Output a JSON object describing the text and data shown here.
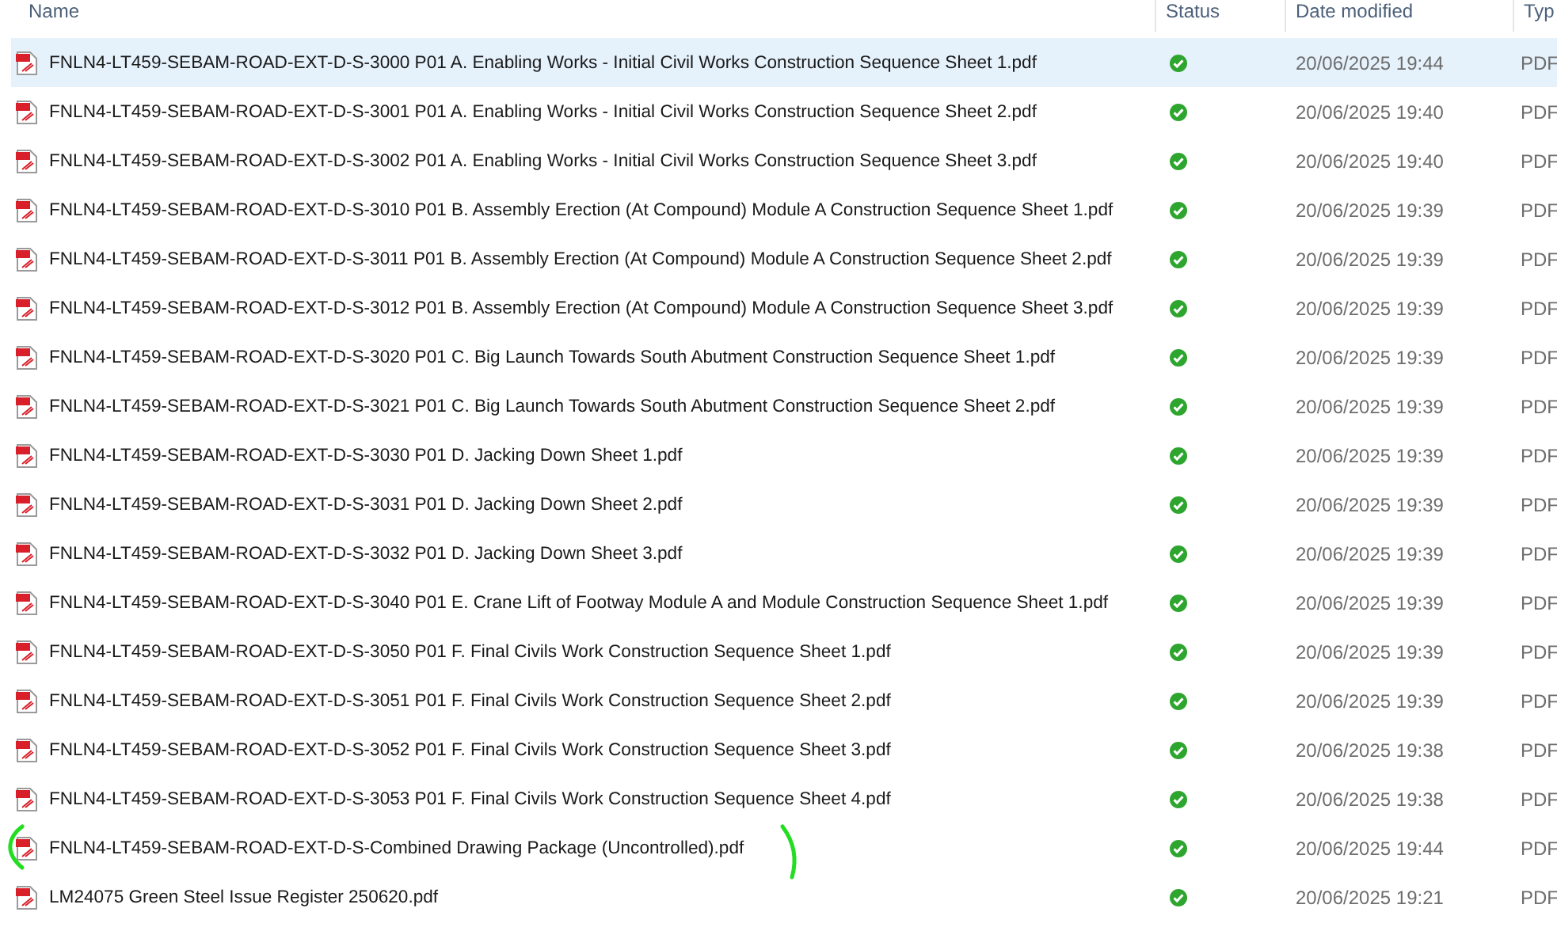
{
  "columns": [
    {
      "label": "Name"
    },
    {
      "label": "Status"
    },
    {
      "label": "Date modified"
    },
    {
      "label": "Typ"
    }
  ],
  "rows": [
    {
      "name": "FNLN4-LT459-SEBAM-ROAD-EXT-D-S-3000 P01 A. Enabling Works - Initial Civil Works Construction Sequence Sheet 1.pdf",
      "synced": true,
      "date": "20/06/2025 19:44",
      "type": "PDF",
      "selected": true
    },
    {
      "name": "FNLN4-LT459-SEBAM-ROAD-EXT-D-S-3001 P01 A. Enabling Works - Initial Civil Works Construction Sequence Sheet 2.pdf",
      "synced": true,
      "date": "20/06/2025 19:40",
      "type": "PDF",
      "selected": false
    },
    {
      "name": "FNLN4-LT459-SEBAM-ROAD-EXT-D-S-3002 P01 A. Enabling Works - Initial Civil Works Construction Sequence Sheet 3.pdf",
      "synced": true,
      "date": "20/06/2025 19:40",
      "type": "PDF",
      "selected": false
    },
    {
      "name": "FNLN4-LT459-SEBAM-ROAD-EXT-D-S-3010 P01 B. Assembly Erection (At Compound) Module A Construction Sequence Sheet 1.pdf",
      "synced": true,
      "date": "20/06/2025 19:39",
      "type": "PDF",
      "selected": false
    },
    {
      "name": "FNLN4-LT459-SEBAM-ROAD-EXT-D-S-3011 P01 B. Assembly Erection (At Compound) Module A Construction Sequence Sheet 2.pdf",
      "synced": true,
      "date": "20/06/2025 19:39",
      "type": "PDF",
      "selected": false
    },
    {
      "name": "FNLN4-LT459-SEBAM-ROAD-EXT-D-S-3012 P01 B. Assembly Erection (At Compound) Module A Construction Sequence Sheet 3.pdf",
      "synced": true,
      "date": "20/06/2025 19:39",
      "type": "PDF",
      "selected": false
    },
    {
      "name": "FNLN4-LT459-SEBAM-ROAD-EXT-D-S-3020 P01 C. Big Launch Towards South Abutment Construction Sequence Sheet 1.pdf",
      "synced": true,
      "date": "20/06/2025 19:39",
      "type": "PDF",
      "selected": false
    },
    {
      "name": "FNLN4-LT459-SEBAM-ROAD-EXT-D-S-3021 P01 C. Big Launch Towards South Abutment Construction Sequence Sheet 2.pdf",
      "synced": true,
      "date": "20/06/2025 19:39",
      "type": "PDF",
      "selected": false
    },
    {
      "name": "FNLN4-LT459-SEBAM-ROAD-EXT-D-S-3030 P01 D. Jacking Down Sheet 1.pdf",
      "synced": true,
      "date": "20/06/2025 19:39",
      "type": "PDF",
      "selected": false
    },
    {
      "name": "FNLN4-LT459-SEBAM-ROAD-EXT-D-S-3031 P01 D. Jacking Down Sheet 2.pdf",
      "synced": true,
      "date": "20/06/2025 19:39",
      "type": "PDF",
      "selected": false
    },
    {
      "name": "FNLN4-LT459-SEBAM-ROAD-EXT-D-S-3032 P01 D. Jacking Down Sheet 3.pdf",
      "synced": true,
      "date": "20/06/2025 19:39",
      "type": "PDF",
      "selected": false
    },
    {
      "name": "FNLN4-LT459-SEBAM-ROAD-EXT-D-S-3040 P01 E. Crane Lift of Footway Module A and Module Construction Sequence Sheet 1.pdf",
      "synced": true,
      "date": "20/06/2025 19:39",
      "type": "PDF",
      "selected": false
    },
    {
      "name": "FNLN4-LT459-SEBAM-ROAD-EXT-D-S-3050 P01 F. Final Civils Work Construction Sequence Sheet 1.pdf",
      "synced": true,
      "date": "20/06/2025 19:39",
      "type": "PDF",
      "selected": false
    },
    {
      "name": "FNLN4-LT459-SEBAM-ROAD-EXT-D-S-3051 P01 F. Final Civils Work Construction Sequence Sheet 2.pdf",
      "synced": true,
      "date": "20/06/2025 19:39",
      "type": "PDF",
      "selected": false
    },
    {
      "name": "FNLN4-LT459-SEBAM-ROAD-EXT-D-S-3052 P01 F. Final Civils Work Construction Sequence Sheet 3.pdf",
      "synced": true,
      "date": "20/06/2025 19:38",
      "type": "PDF",
      "selected": false
    },
    {
      "name": "FNLN4-LT459-SEBAM-ROAD-EXT-D-S-3053 P01 F. Final Civils Work Construction Sequence Sheet 4.pdf",
      "synced": true,
      "date": "20/06/2025 19:38",
      "type": "PDF",
      "selected": false
    },
    {
      "name": "FNLN4-LT459-SEBAM-ROAD-EXT-D-S-Combined Drawing Package (Uncontrolled).pdf",
      "synced": true,
      "date": "20/06/2025 19:44",
      "type": "PDF",
      "selected": false
    },
    {
      "name": "LM24075 Green Steel Issue Register 250620.pdf",
      "synced": true,
      "date": "20/06/2025 19:21",
      "type": "PDF",
      "selected": false
    }
  ]
}
